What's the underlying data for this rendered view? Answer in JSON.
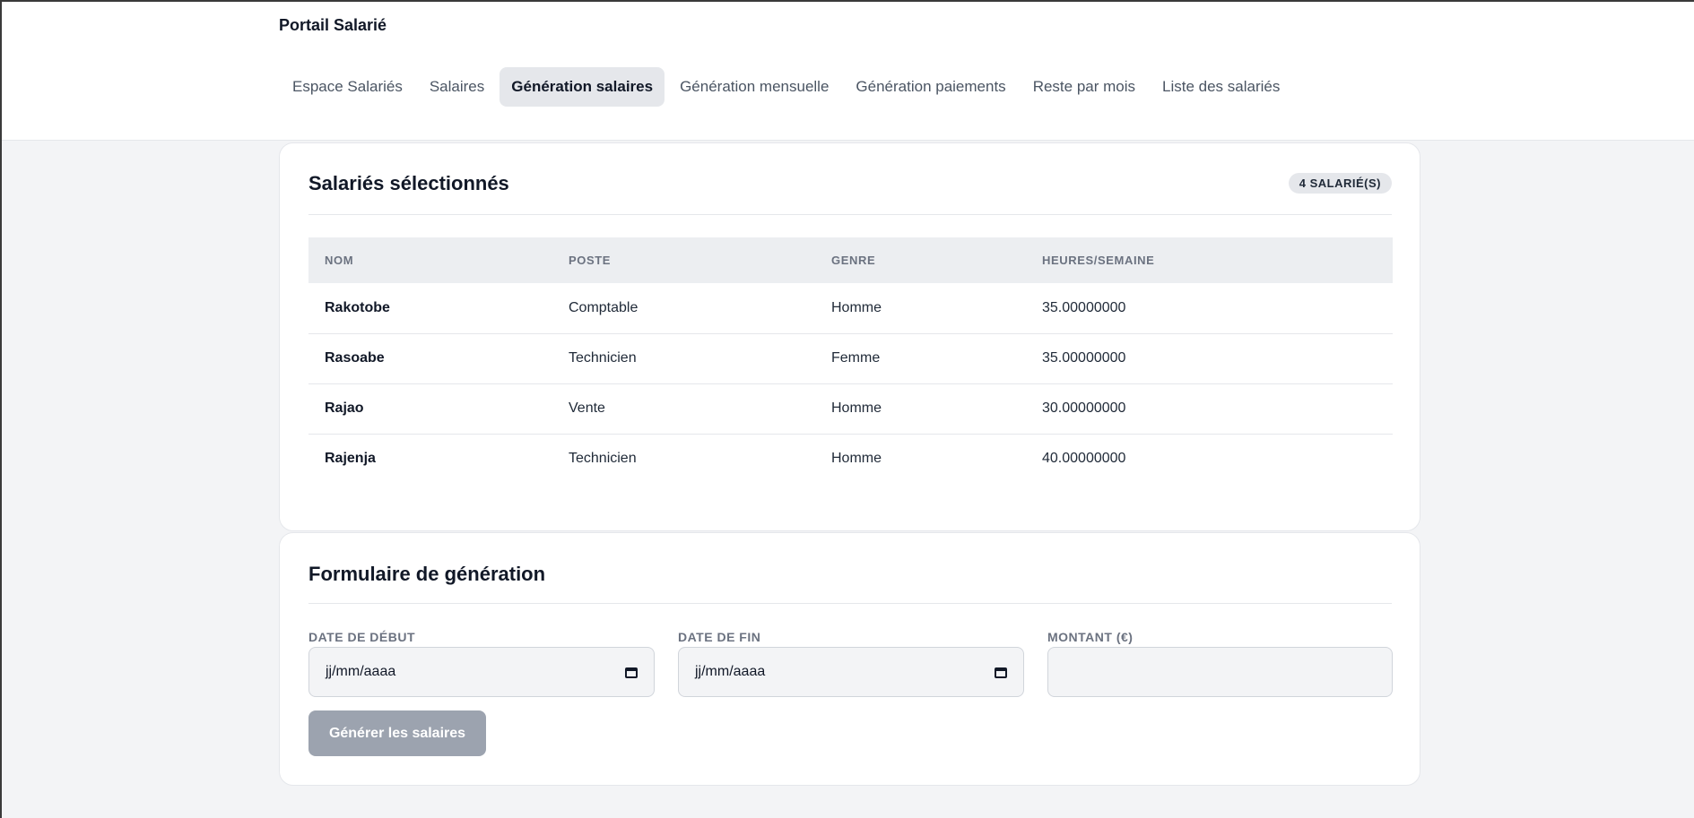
{
  "app": {
    "title": "Portail Salarié"
  },
  "nav": [
    {
      "label": "Espace Salariés",
      "active": false
    },
    {
      "label": "Salaires",
      "active": false
    },
    {
      "label": "Génération salaires",
      "active": true
    },
    {
      "label": "Génération mensuelle",
      "active": false
    },
    {
      "label": "Génération paiements",
      "active": false
    },
    {
      "label": "Reste par mois",
      "active": false
    },
    {
      "label": "Liste des salariés",
      "active": false
    }
  ],
  "selected": {
    "title": "Salariés sélectionnés",
    "badge": "4 SALARIÉ(S)",
    "columns": [
      "NOM",
      "POSTE",
      "GENRE",
      "HEURES/SEMAINE"
    ],
    "rows": [
      {
        "nom": "Rakotobe",
        "poste": "Comptable",
        "genre": "Homme",
        "heures": "35.00000000"
      },
      {
        "nom": "Rasoabe",
        "poste": "Technicien",
        "genre": "Femme",
        "heures": "35.00000000"
      },
      {
        "nom": "Rajao",
        "poste": "Vente",
        "genre": "Homme",
        "heures": "30.00000000"
      },
      {
        "nom": "Rajenja",
        "poste": "Technicien",
        "genre": "Homme",
        "heures": "40.00000000"
      }
    ]
  },
  "form": {
    "title": "Formulaire de génération",
    "date_debut": {
      "label": "DATE DE DÉBUT",
      "placeholder": "jj/mm/aaaa"
    },
    "date_fin": {
      "label": "DATE DE FIN",
      "placeholder": "jj/mm/aaaa"
    },
    "montant": {
      "label": "MONTANT (€)",
      "value": ""
    },
    "submit_label": "Générer les salaires"
  }
}
